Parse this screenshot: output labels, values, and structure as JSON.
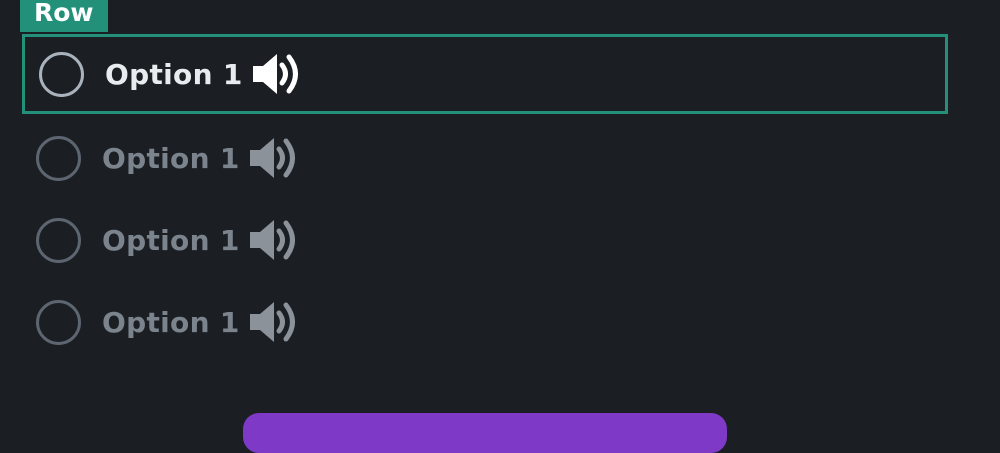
{
  "question_tag": {
    "label": "Row"
  },
  "options": [
    {
      "label": "Option 1",
      "icon": "speaker-icon",
      "focused": true
    },
    {
      "label": "Option 1",
      "icon": "speaker-icon",
      "focused": false
    },
    {
      "label": "Option 1",
      "icon": "speaker-icon",
      "focused": false
    },
    {
      "label": "Option 1",
      "icon": "speaker-icon",
      "focused": false
    }
  ],
  "colors": {
    "background": "#1b1f24",
    "accent": "#23907a",
    "focused_text": "#e8ecef",
    "muted_text": "#7b838d",
    "button": "#7e3ac6"
  }
}
